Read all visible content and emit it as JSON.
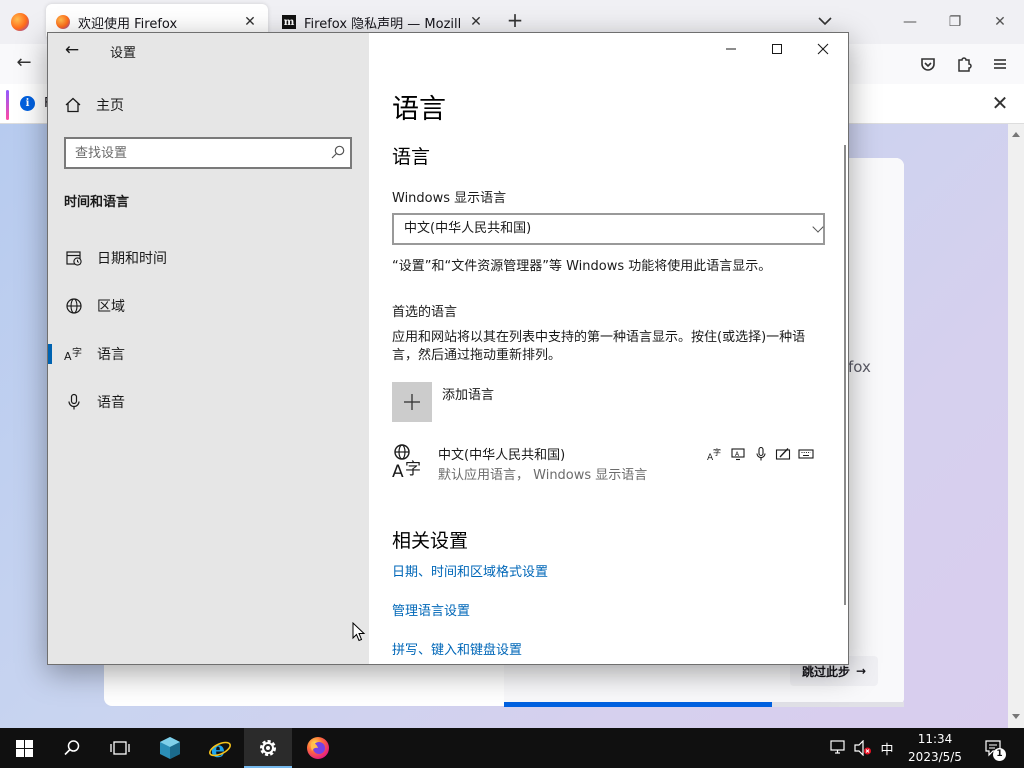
{
  "firefox": {
    "tabs": [
      {
        "title": "欢迎使用 Firefox",
        "active": true
      },
      {
        "title": "Firefox 隐私声明 — Mozilla",
        "active": false
      }
    ],
    "newtab_label": "+",
    "notification_text": "F",
    "card_text": "fox",
    "skip_label": "跳过此步",
    "progress_fraction": 0.67
  },
  "settings": {
    "app_title": "设置",
    "home_label": "主页",
    "search_placeholder": "查找设置",
    "section_title": "时间和语言",
    "nav": [
      {
        "label": "日期和时间",
        "icon": "calendar-icon",
        "selected": false
      },
      {
        "label": "区域",
        "icon": "globe-icon",
        "selected": false
      },
      {
        "label": "语言",
        "icon": "language-icon",
        "selected": true
      },
      {
        "label": "语音",
        "icon": "microphone-icon",
        "selected": false
      }
    ],
    "page_title": "语言",
    "lang_section_title": "语言",
    "display_lang_label": "Windows 显示语言",
    "display_lang_value": "中文(中华人民共和国)",
    "display_lang_desc": "“设置”和“文件资源管理器”等 Windows 功能将使用此语言显示。",
    "preferred_title": "首选的语言",
    "preferred_desc": "应用和网站将以其在列表中支持的第一种语言显示。按住(或选择)一种语言，然后通过拖动重新排列。",
    "add_language_label": "添加语言",
    "language_item": {
      "name": "中文(中华人民共和国)",
      "subtitle": "默认应用语言， Windows 显示语言",
      "features": [
        "language-pack-icon",
        "display-icon",
        "speech-icon",
        "handwriting-icon",
        "keyboard-icon"
      ]
    },
    "related_title": "相关设置",
    "related_links": [
      "日期、时间和区域格式设置",
      "管理语言设置",
      "拼写、键入和键盘设置"
    ]
  },
  "taskbar": {
    "pinned": [
      "start-button",
      "search-button",
      "task-view-button",
      "server-manager-icon",
      "internet-explorer-icon",
      "settings-icon",
      "firefox-icon"
    ],
    "ime_label": "中",
    "time": "11:34",
    "date": "2023/5/5",
    "notification_count": "1",
    "colors": {
      "taskbar": "#101010",
      "accent": "#0063b1",
      "link": "#0067b8"
    }
  }
}
